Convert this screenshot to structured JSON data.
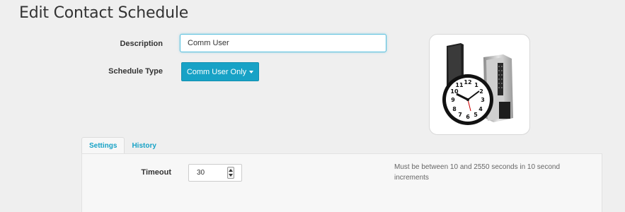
{
  "page": {
    "title": "Edit Contact Schedule"
  },
  "form": {
    "description_label": "Description",
    "description_value": "Comm User",
    "schedule_type_label": "Schedule Type",
    "schedule_type_value": "Comm User Only"
  },
  "image": {
    "icon": "clock-and-keypad-reader-icon"
  },
  "tabs": [
    {
      "label": "Settings",
      "active": true
    },
    {
      "label": "History",
      "active": false
    }
  ],
  "settings": {
    "timeout_label": "Timeout",
    "timeout_value": "30",
    "timeout_help": "Must be between 10 and 2550 seconds in 10 second increments"
  },
  "colors": {
    "accent": "#17a2c6",
    "background": "#efefef"
  }
}
